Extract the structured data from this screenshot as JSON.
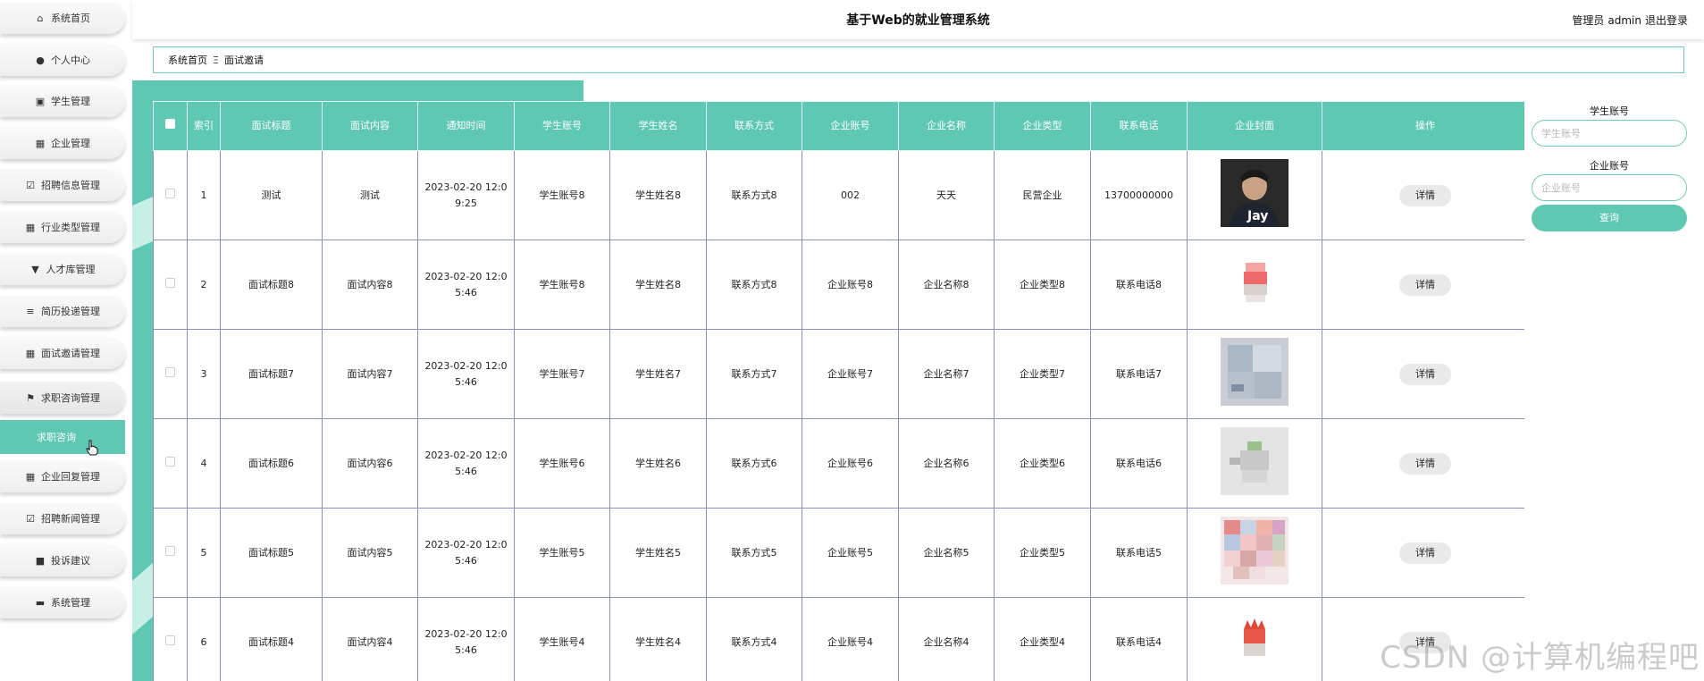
{
  "header": {
    "title": "基于Web的就业管理系统",
    "user_role": "管理员",
    "username": "admin",
    "logout": "退出登录"
  },
  "sidebar": {
    "items": [
      {
        "label": "系统首页",
        "icon": "home-icon"
      },
      {
        "label": "个人中心",
        "icon": "user-icon"
      },
      {
        "label": "学生管理",
        "icon": "calendar-check-icon"
      },
      {
        "label": "企业管理",
        "icon": "grid-icon"
      },
      {
        "label": "招聘信息管理",
        "icon": "checkbox-icon"
      },
      {
        "label": "行业类型管理",
        "icon": "grid-icon"
      },
      {
        "label": "人才库管理",
        "icon": "pin-icon"
      },
      {
        "label": "简历投递管理",
        "icon": "list-icon"
      },
      {
        "label": "面试邀请管理",
        "icon": "grid-icon"
      },
      {
        "label": "求职咨询管理",
        "icon": "flag-icon"
      },
      {
        "label": "企业回复管理",
        "icon": "grid-icon"
      },
      {
        "label": "招聘新闻管理",
        "icon": "checkbox-icon"
      },
      {
        "label": "投诉建议",
        "icon": "video-icon"
      },
      {
        "label": "系统管理",
        "icon": "database-icon"
      }
    ],
    "submenu": {
      "label": "求职咨询"
    }
  },
  "breadcrumb": {
    "home": "系统首页",
    "separator": "Ξ",
    "current": "面试邀请"
  },
  "table": {
    "columns": [
      "索引",
      "面试标题",
      "面试内容",
      "通知时间",
      "学生账号",
      "学生姓名",
      "联系方式",
      "企业账号",
      "企业名称",
      "企业类型",
      "联系电话",
      "企业封面",
      "操作"
    ],
    "detail_label": "详情",
    "rows": [
      {
        "index": "1",
        "title": "测试",
        "content": "测试",
        "time_line1": "2023-02-20 12:0",
        "time_line2": "9:25",
        "student_account": "学生账号8",
        "student_name": "学生姓名8",
        "contact": "联系方式8",
        "company_account": "002",
        "company_name": "天天",
        "company_type": "民营企业",
        "phone": "13700000000",
        "cover": "person-photo"
      },
      {
        "index": "2",
        "title": "面试标题8",
        "content": "面试内容8",
        "time_line1": "2023-02-20 12:0",
        "time_line2": "5:46",
        "student_account": "学生账号8",
        "student_name": "学生姓名8",
        "contact": "联系方式8",
        "company_account": "企业账号8",
        "company_name": "企业名称8",
        "company_type": "企业类型8",
        "phone": "联系电话8",
        "cover": "red-product"
      },
      {
        "index": "3",
        "title": "面试标题7",
        "content": "面试内容7",
        "time_line1": "2023-02-20 12:0",
        "time_line2": "5:46",
        "student_account": "学生账号7",
        "student_name": "学生姓名7",
        "contact": "联系方式7",
        "company_account": "企业账号7",
        "company_name": "企业名称7",
        "company_type": "企业类型7",
        "phone": "联系电话7",
        "cover": "blurred-poster"
      },
      {
        "index": "4",
        "title": "面试标题6",
        "content": "面试内容6",
        "time_line1": "2023-02-20 12:0",
        "time_line2": "5:46",
        "student_account": "学生账号6",
        "student_name": "学生姓名6",
        "contact": "联系方式6",
        "company_account": "企业账号6",
        "company_name": "企业名称6",
        "company_type": "企业类型6",
        "phone": "联系电话6",
        "cover": "gray-product"
      },
      {
        "index": "5",
        "title": "面试标题5",
        "content": "面试内容5",
        "time_line1": "2023-02-20 12:0",
        "time_line2": "5:46",
        "student_account": "学生账号5",
        "student_name": "学生姓名5",
        "contact": "联系方式5",
        "company_account": "企业账号5",
        "company_name": "企业名称5",
        "company_type": "企业类型5",
        "phone": "联系电话5",
        "cover": "colorful-collage"
      },
      {
        "index": "6",
        "title": "面试标题4",
        "content": "面试内容4",
        "time_line1": "2023-02-20 12:0",
        "time_line2": "5:46",
        "student_account": "学生账号4",
        "student_name": "学生姓名4",
        "contact": "联系方式4",
        "company_account": "企业账号4",
        "company_name": "企业名称4",
        "company_type": "企业类型4",
        "phone": "联系电话4",
        "cover": "red-product"
      }
    ]
  },
  "search": {
    "student_account_label": "学生账号",
    "student_account_placeholder": "学生账号",
    "company_account_label": "企业账号",
    "company_account_placeholder": "企业账号",
    "query_button": "查询"
  },
  "watermark": "CSDN @计算机编程吧",
  "colors": {
    "accent": "#5fc8b2",
    "table_border": "#8a8fb8"
  }
}
